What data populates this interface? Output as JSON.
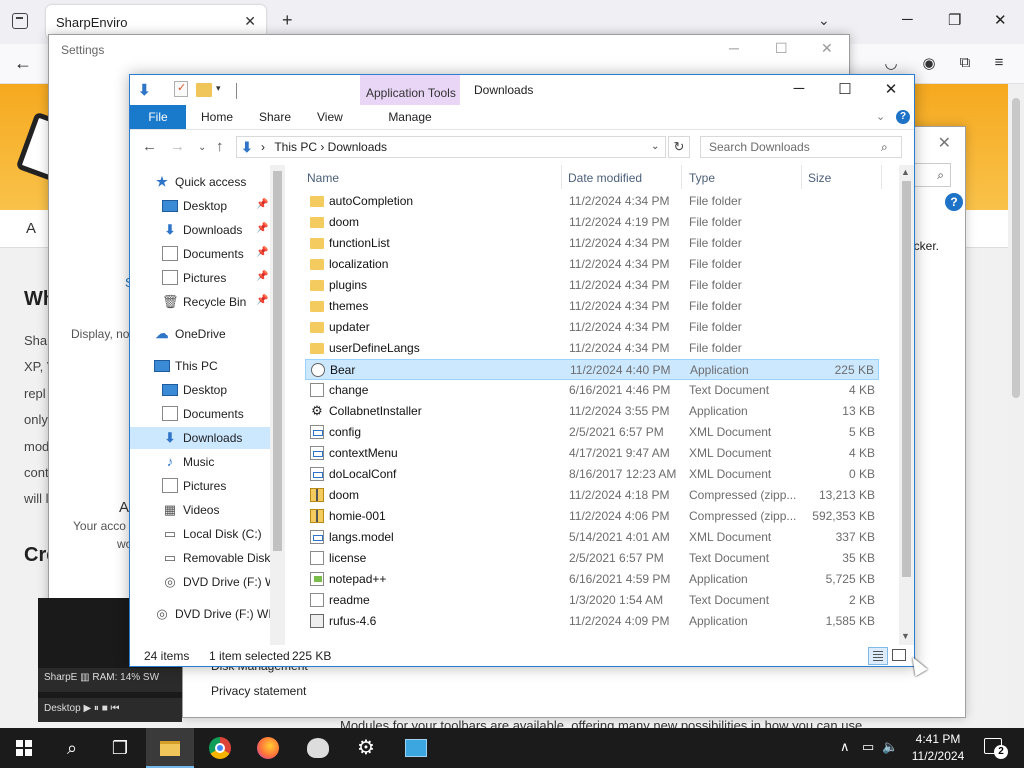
{
  "browser": {
    "tab_title": "SharpEnviro",
    "tab_close": "✕",
    "new_tab": "+",
    "list_all_tabs": "⌄",
    "minimize": "─",
    "maximize": "❐",
    "close": "✕",
    "back": "←"
  },
  "website": {
    "nav_letter": "A",
    "heading1": "Wh",
    "lines": [
      "Sha",
      "XP, V",
      "repl",
      "only",
      "mod",
      "cont",
      "will l"
    ],
    "heading2": "Cre",
    "footer_text": "Modules for your toolbars are available, offering many new possibilities in how you can use"
  },
  "settings": {
    "title": "Settings",
    "minimize": "─",
    "maximize": "☐",
    "close": "✕",
    "display_text": "Display, no",
    "account_a": "A",
    "account_text": "Your acco",
    "account_text2": "wo",
    "s_icon_text": "S"
  },
  "dialog2": {
    "close": "✕",
    "help": "?",
    "text_fragment": "cker.",
    "disk_management": "Disk Management",
    "privacy": "Privacy statement"
  },
  "sharpe_widget": {
    "bar1_text": "SharpE  ▥  RAM: 14%  SW",
    "bar2_text": "Desktop  ▶ ⏸ ■ ⏮"
  },
  "explorer": {
    "title": "Downloads",
    "app_tools_label": "Application Tools",
    "ribbon_tabs": {
      "file": "File",
      "home": "Home",
      "share": "Share",
      "view": "View",
      "manage": "Manage"
    },
    "window_buttons": {
      "minimize": "─",
      "maximize": "☐",
      "close": "✕"
    },
    "address": {
      "crumbs": "This PC  ›  Downloads",
      "leading_chevron": "›"
    },
    "search": {
      "placeholder": "Search Downloads"
    },
    "nav_pane": [
      {
        "label": "Quick access",
        "icon": "star-icon"
      },
      {
        "label": "Desktop",
        "icon": "desktop-icon",
        "pinned": true
      },
      {
        "label": "Downloads",
        "icon": "download-icon",
        "pinned": true
      },
      {
        "label": "Documents",
        "icon": "documents-icon",
        "pinned": true
      },
      {
        "label": "Pictures",
        "icon": "pictures-icon",
        "pinned": true
      },
      {
        "label": "Recycle Bin",
        "icon": "recycle-bin-icon",
        "pinned": true
      },
      {
        "label": "OneDrive",
        "icon": "cloud-icon"
      },
      {
        "label": "This PC",
        "icon": "computer-icon"
      },
      {
        "label": "Desktop",
        "icon": "desktop-icon"
      },
      {
        "label": "Documents",
        "icon": "documents-icon"
      },
      {
        "label": "Downloads",
        "icon": "download-icon",
        "selected": true
      },
      {
        "label": "Music",
        "icon": "music-icon"
      },
      {
        "label": "Pictures",
        "icon": "pictures-icon"
      },
      {
        "label": "Videos",
        "icon": "videos-icon"
      },
      {
        "label": "Local Disk (C:)",
        "icon": "local-disk-icon"
      },
      {
        "label": "Removable Disk",
        "icon": "removable-disk-icon"
      },
      {
        "label": "DVD Drive (F:) W",
        "icon": "dvd-drive-icon"
      },
      {
        "label": "DVD Drive (F:) WIN",
        "icon": "dvd-drive-icon"
      }
    ],
    "columns": {
      "name": "Name",
      "date": "Date modified",
      "type": "Type",
      "size": "Size"
    },
    "files": [
      {
        "name": "autoCompletion",
        "date": "11/2/2024 4:34 PM",
        "type": "File folder",
        "size": "",
        "icon": "folder-icon"
      },
      {
        "name": "doom",
        "date": "11/2/2024 4:19 PM",
        "type": "File folder",
        "size": "",
        "icon": "folder-icon"
      },
      {
        "name": "functionList",
        "date": "11/2/2024 4:34 PM",
        "type": "File folder",
        "size": "",
        "icon": "folder-icon"
      },
      {
        "name": "localization",
        "date": "11/2/2024 4:34 PM",
        "type": "File folder",
        "size": "",
        "icon": "folder-icon"
      },
      {
        "name": "plugins",
        "date": "11/2/2024 4:34 PM",
        "type": "File folder",
        "size": "",
        "icon": "folder-icon"
      },
      {
        "name": "themes",
        "date": "11/2/2024 4:34 PM",
        "type": "File folder",
        "size": "",
        "icon": "folder-icon"
      },
      {
        "name": "updater",
        "date": "11/2/2024 4:34 PM",
        "type": "File folder",
        "size": "",
        "icon": "folder-icon"
      },
      {
        "name": "userDefineLangs",
        "date": "11/2/2024 4:34 PM",
        "type": "File folder",
        "size": "",
        "icon": "folder-icon"
      },
      {
        "name": "Bear",
        "date": "11/2/2024 4:40 PM",
        "type": "Application",
        "size": "225 KB",
        "icon": "bear-app-icon",
        "selected": true
      },
      {
        "name": "change",
        "date": "6/16/2021 4:46 PM",
        "type": "Text Document",
        "size": "4 KB",
        "icon": "text-file-icon"
      },
      {
        "name": "CollabnetInstaller",
        "date": "11/2/2024 3:55 PM",
        "type": "Application",
        "size": "13 KB",
        "icon": "gear-app-icon"
      },
      {
        "name": "config",
        "date": "2/5/2021 6:57 PM",
        "type": "XML Document",
        "size": "5 KB",
        "icon": "xml-file-icon"
      },
      {
        "name": "contextMenu",
        "date": "4/17/2021 9:47 AM",
        "type": "XML Document",
        "size": "4 KB",
        "icon": "xml-file-icon"
      },
      {
        "name": "doLocalConf",
        "date": "8/16/2017 12:23 AM",
        "type": "XML Document",
        "size": "0 KB",
        "icon": "xml-file-icon"
      },
      {
        "name": "doom",
        "date": "11/2/2024 4:18 PM",
        "type": "Compressed (zipp...",
        "size": "13,213 KB",
        "icon": "zip-file-icon"
      },
      {
        "name": "homie-001",
        "date": "11/2/2024 4:06 PM",
        "type": "Compressed (zipp...",
        "size": "592,353 KB",
        "icon": "zip-file-icon"
      },
      {
        "name": "langs.model",
        "date": "5/14/2021 4:01 AM",
        "type": "XML Document",
        "size": "337 KB",
        "icon": "xml-file-icon"
      },
      {
        "name": "license",
        "date": "2/5/2021 6:57 PM",
        "type": "Text Document",
        "size": "35 KB",
        "icon": "text-file-icon"
      },
      {
        "name": "notepad++",
        "date": "6/16/2021 4:59 PM",
        "type": "Application",
        "size": "5,725 KB",
        "icon": "notepad-app-icon"
      },
      {
        "name": "readme",
        "date": "1/3/2020 1:54 AM",
        "type": "Text Document",
        "size": "2 KB",
        "icon": "text-file-icon"
      },
      {
        "name": "rufus-4.6",
        "date": "11/2/2024 4:09 PM",
        "type": "Application",
        "size": "1,585 KB",
        "icon": "usb-app-icon"
      }
    ],
    "status": {
      "count": "24 items",
      "selected": "1 item selected",
      "size": "225 KB"
    }
  },
  "taskbar": {
    "clock_time": "4:41 PM",
    "clock_date": "11/2/2024",
    "notifications": "2",
    "tray_chevron": "∧"
  },
  "colors": {
    "accent": "#1979ca",
    "selection": "#cce8ff",
    "app_tools": "#e9d6f6",
    "site_header": "#f6a91f",
    "taskbar": "#1b1b1b"
  }
}
